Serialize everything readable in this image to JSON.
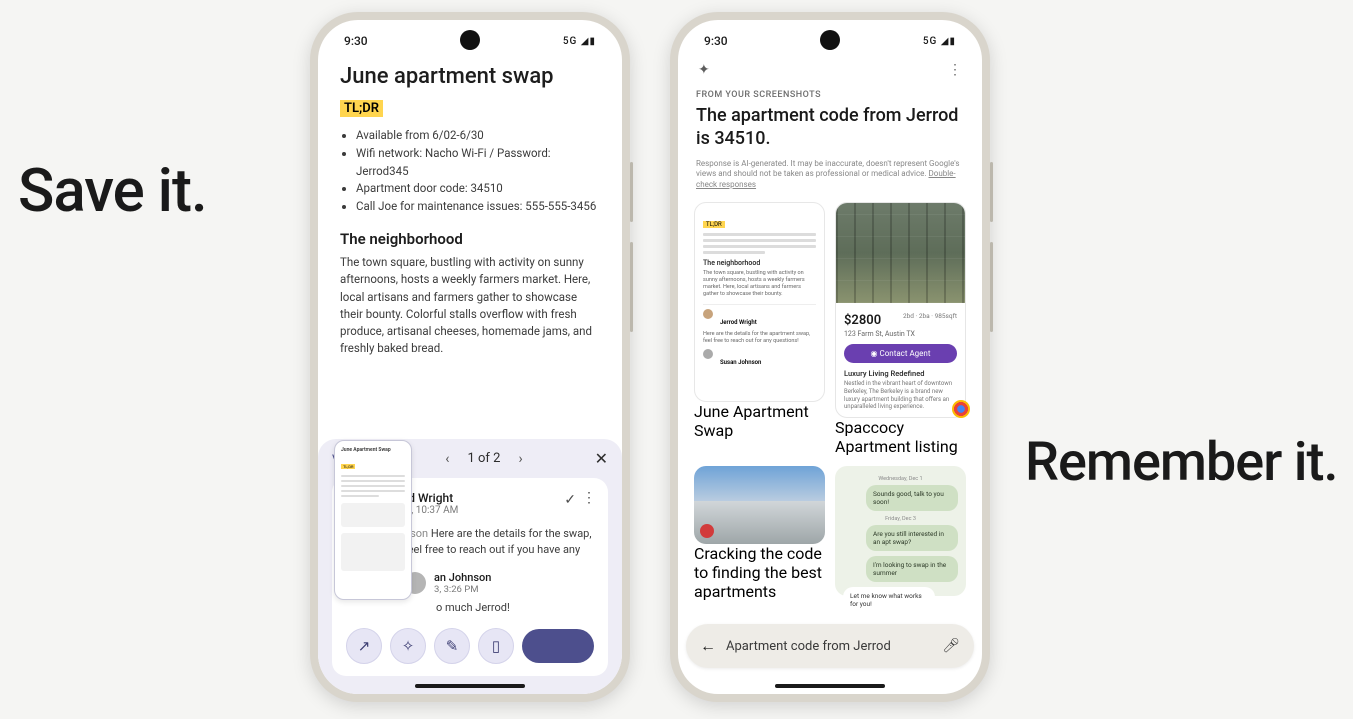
{
  "taglines": {
    "left": "Save it.",
    "right": "Remember it."
  },
  "status": {
    "time": "9:30",
    "net": "5G ◢▮"
  },
  "phone1": {
    "title": "June apartment swap",
    "tldr": "TL;DR",
    "bullets": [
      "Available from 6/02-6/30",
      "Wifi network: Nacho Wi-Fi / Password: Jerrod345",
      "Apartment door code: 34510",
      "Call Joe for maintenance issues: 555-555-3456"
    ],
    "subhead": "The neighborhood",
    "paragraph": "The town square, bustling with activity on sunny afternoons, hosts a weekly farmers market. Here, local artisans and farmers gather to showcase their bounty. Colorful stalls overflow with fresh produce, artisanal cheeses, homemade jams, and freshly baked bread.",
    "sheet": {
      "viewAll": "View all",
      "page": "1 of 2",
      "sender": "Jerrod Wright",
      "senderDate": "Mar 13, 10:37 AM",
      "message": "Here are the details for the swap, feel free to reach out if you have any",
      "replyName": "an Johnson",
      "replyDate": "3, 3:26 PM",
      "replyMsg": "o much Jerrod!"
    },
    "mini": {
      "title": "June Apartment Swap"
    }
  },
  "phone2": {
    "eyebrow": "FROM YOUR SCREENSHOTS",
    "answer": "The apartment code from Jerrod is 34510.",
    "disclaimer": "Response is AI-generated. It may be inaccurate, doesn't represent Google's views and should not be taken as professional or medical advice.",
    "disclaimerLink": "Double-check responses",
    "card1": {
      "label": "June Apartment Swap",
      "tldr": "TL;DR",
      "hd": "The neighborhood",
      "txt": "The town square, bustling with activity on sunny afternoons, hosts a weekly farmers market. Here, local artisans and farmers gather to showcase their bounty.",
      "msgName": "Jerrod Wright",
      "msgBody": "Here are the details for the apartment swap, feel free to reach out for any questions!",
      "replyName": "Susan Johnson"
    },
    "card2": {
      "label": "Spaccocy Apartment listing",
      "price": "$2800",
      "meta": "2bd · 2ba · 985sqft",
      "addr": "123 Farm St, Austin TX",
      "cta": "◉  Contact Agent",
      "descHd": "Luxury Living Redefined",
      "desc": "Nestled in the vibrant heart of downtown Berkeley, The Berkeley is a brand new luxury apartment building that offers an unparalleled living experience."
    },
    "card3": {
      "label": "Cracking the code to finding the best apartments"
    },
    "card4": {
      "ts1": "Wednesday, Dec 1",
      "b1": "Sounds good, talk to you soon!",
      "ts2": "Friday, Dec 3",
      "b2": "Are you still interested in an apt swap?",
      "b3": "I'm looking to swap in the summer",
      "b4": "Let me know what works for you!"
    },
    "search": "Apartment code from Jerrod"
  }
}
